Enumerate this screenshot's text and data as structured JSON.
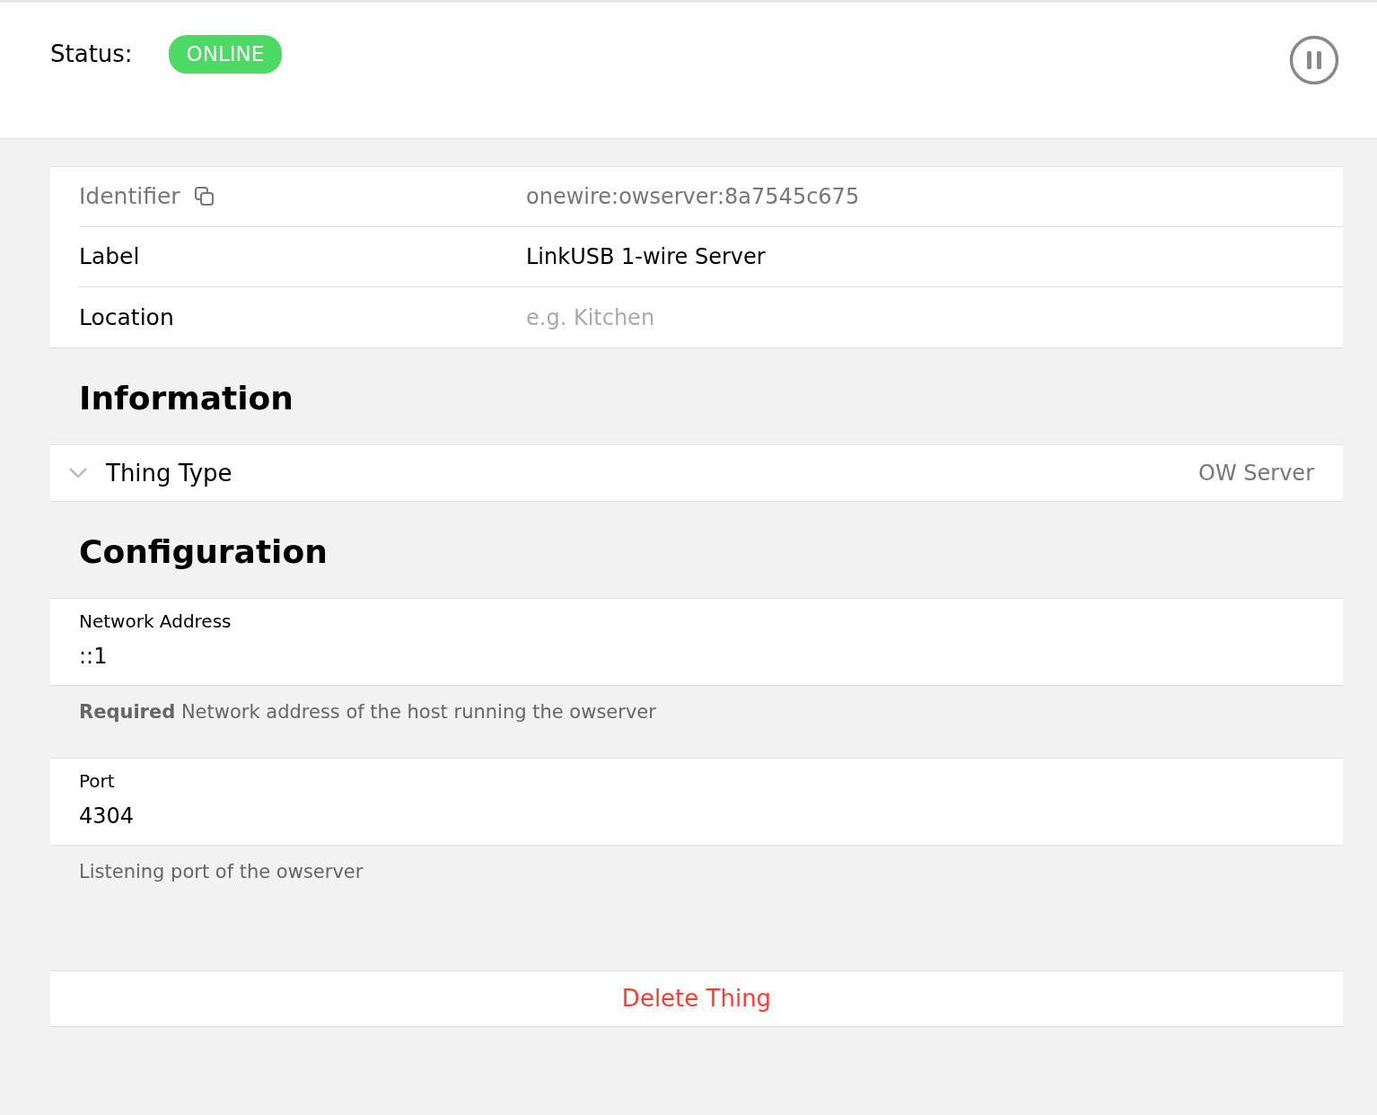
{
  "status": {
    "label": "Status:",
    "badge": "ONLINE",
    "online": true
  },
  "properties": [
    {
      "kind": "copyable",
      "label": "Identifier",
      "value": "onewire:owserver:8a7545c675"
    },
    {
      "kind": "value",
      "label": "Label",
      "value": "LinkUSB 1-wire Server"
    },
    {
      "kind": "input",
      "label": "Location",
      "placeholder": "e.g. Kitchen"
    }
  ],
  "information": {
    "heading": "Information",
    "items": [
      {
        "label": "Thing Type",
        "value": "OW Server",
        "expanded": false
      }
    ]
  },
  "configuration": {
    "heading": "Configuration",
    "parameters": [
      {
        "label": "Network Address",
        "value": "::1",
        "description": "**Required** Network address of the host running the owserver"
      },
      {
        "label": "Port",
        "value": "4304",
        "description": "Listening port of the owserver"
      }
    ]
  },
  "delete_button": "Delete Thing"
}
